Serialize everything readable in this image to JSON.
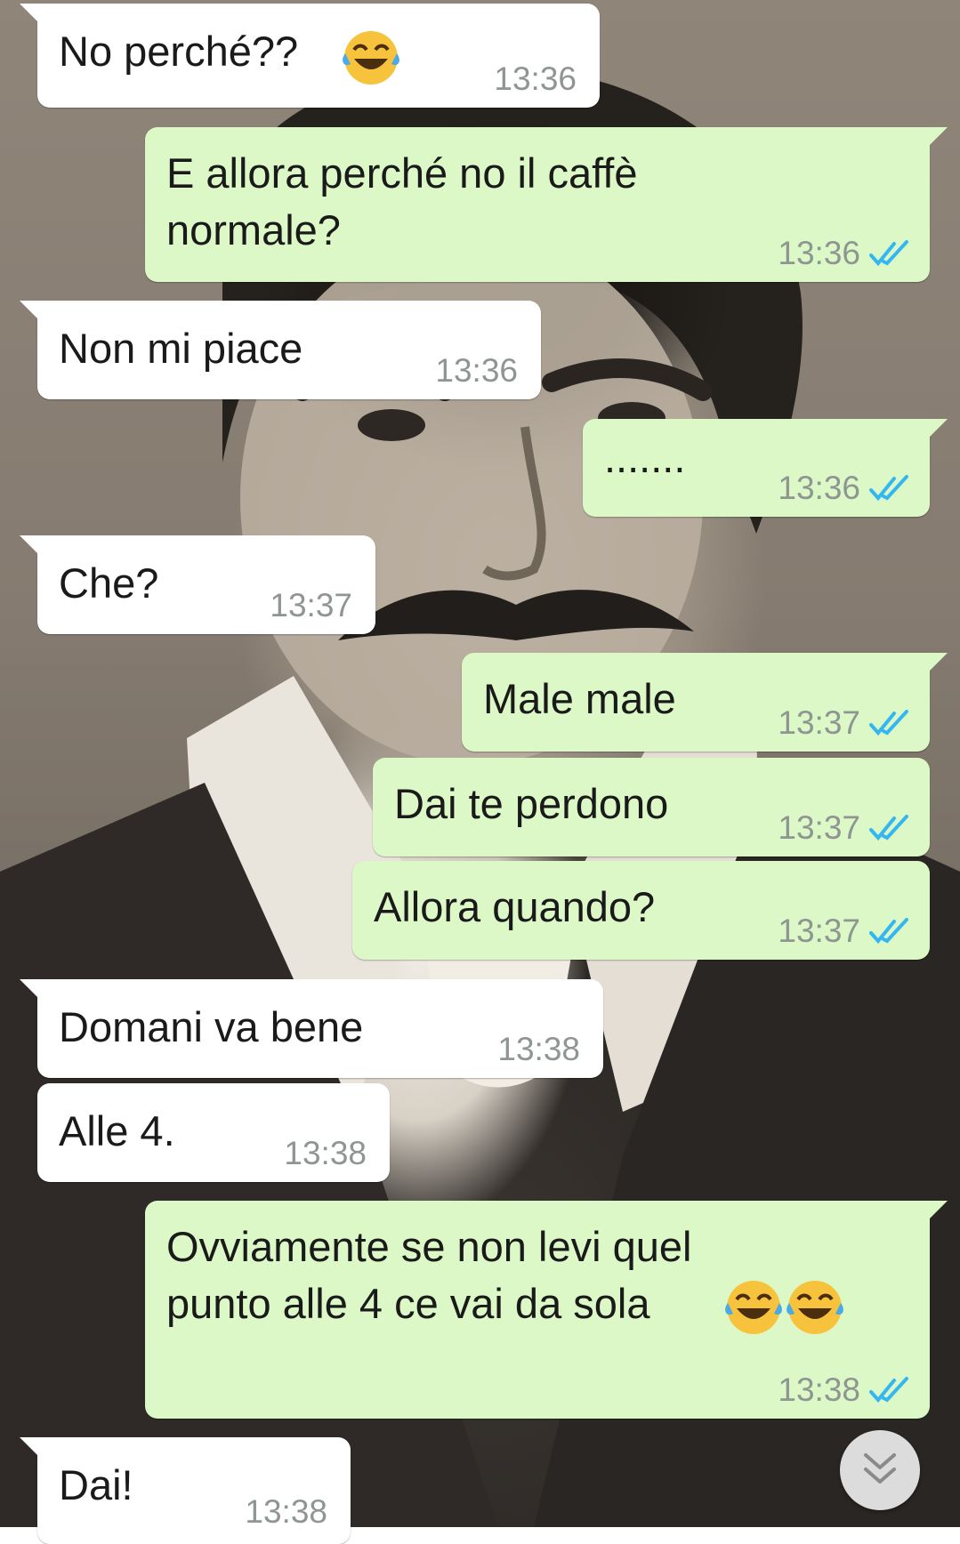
{
  "wallpaper": {
    "icon": "vintage-portrait-photo"
  },
  "colors": {
    "incoming": "#ffffff",
    "outgoing": "#dcf8c6",
    "time": "#8f9692",
    "read_ticks": "#34b7f1"
  },
  "messages": [
    {
      "direction": "in",
      "text": "No perché??",
      "emoji_after": "face-with-tears-of-joy",
      "time": "13:36"
    },
    {
      "direction": "out",
      "text": "E allora perché no il caffè\nnormale?",
      "time": "13:36",
      "status": "read"
    },
    {
      "direction": "in",
      "text": "Non mi piace",
      "time": "13:36"
    },
    {
      "direction": "out",
      "text": ".......",
      "time": "13:36",
      "status": "read"
    },
    {
      "direction": "in",
      "text": "Che?",
      "time": "13:37"
    },
    {
      "direction": "out",
      "text": "Male male",
      "time": "13:37",
      "status": "read"
    },
    {
      "direction": "out",
      "text": "Dai te perdono",
      "time": "13:37",
      "status": "read"
    },
    {
      "direction": "out",
      "text": "Allora quando?",
      "time": "13:37",
      "status": "read"
    },
    {
      "direction": "in",
      "text": "Domani va bene",
      "time": "13:38"
    },
    {
      "direction": "in",
      "text": "Alle 4.",
      "time": "13:38"
    },
    {
      "direction": "out",
      "text": "Ovviamente se non levi quel\npunto alle 4 ce vai da sola",
      "emoji_after": "face-with-tears-of-joy x2",
      "time": "13:38",
      "status": "read"
    },
    {
      "direction": "in",
      "text": "Dai!",
      "time": "13:38"
    }
  ],
  "scroll_button": {
    "icon": "double-chevron-down-icon"
  }
}
